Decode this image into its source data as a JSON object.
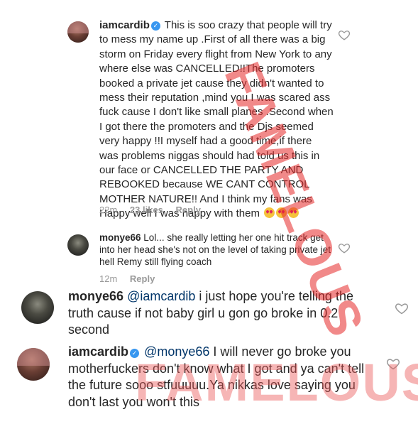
{
  "comments": [
    {
      "username": "iamcardib",
      "verified": true,
      "text": "This is soo crazy that people will try to mess my name up .First of all there was a big storm on Friday every flight from New York to any where else was CANCELLED!!The promoters booked a private jet cause they didn't wanted to mess their reputation ,mind you I was scared ass fuck cause I don't like small planes .Second when I got there the promoters and the Djs seemed very happy !!I myself had a good time,if there was problems niggas should had told us this in our face or CANCELLED THE PARTY AND REBOOKED because WE CANT CONTROL MOTHER NATURE!! And I think my fans was Happy well I was happy with them",
      "emojis": [
        "heart-eyes-emoji",
        "heart-eyes-emoji",
        "heart-eyes-emoji"
      ],
      "time": "22m",
      "likes": "23 likes",
      "reply": "Reply"
    },
    {
      "username": "monye66",
      "text": "Lol... she really letting her one hit track get into her head she's not on the level of taking private jet hell Remy still flying coach",
      "time": "12m",
      "reply": "Reply"
    },
    {
      "username": "monye66",
      "mention": "@iamcardib",
      "text": "i just hope you're telling the truth cause if not baby girl u gon go broke in 0.2 second"
    },
    {
      "username": "iamcardib",
      "verified": true,
      "mention": "@monye66",
      "text": "I will never go broke you motherfuckers don't know what I got and ya can't tell the future sooo stfuuuuu.Ya nikkas love saying you don't last you won't this"
    }
  ],
  "watermark": "FAMELOUS",
  "icons": {
    "like": "heart-outline-icon",
    "verified": "verified-badge-icon"
  },
  "colors": {
    "meta": "#999999",
    "verified": "#3897f0",
    "watermark": "#e62828"
  }
}
